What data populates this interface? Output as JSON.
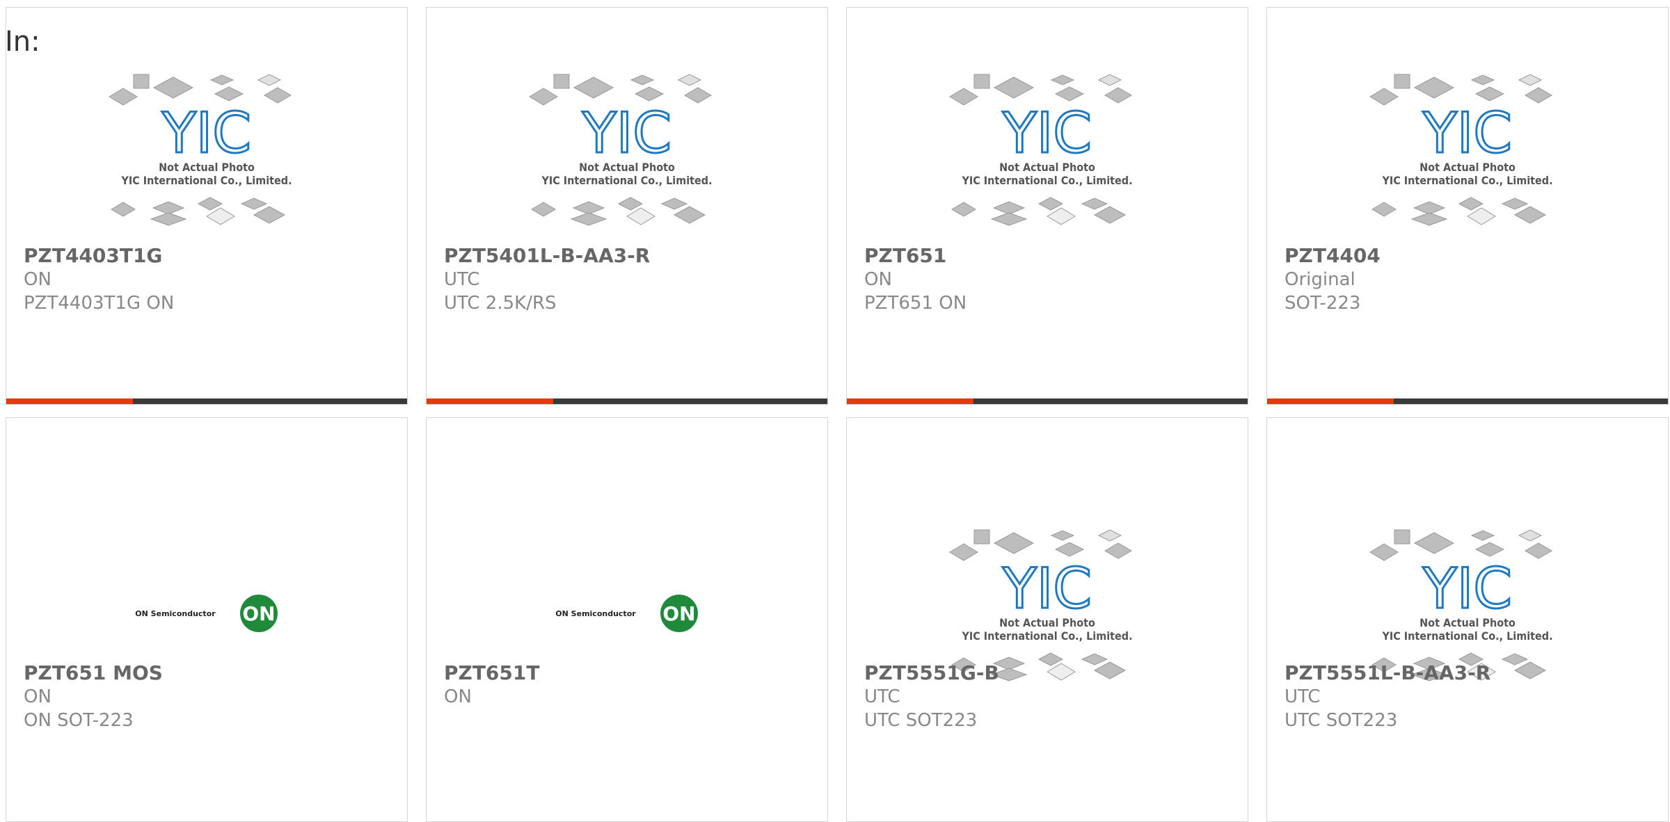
{
  "heading": "In:",
  "colors": {
    "accent": "#e8380d",
    "bar": "#3a3a3a",
    "text": "#777777"
  },
  "placeholder": {
    "logo": "YIC",
    "caption1": "Not Actual Photo",
    "caption2": "YIC International Co., Limited."
  },
  "on_logo": {
    "text": "ON Semiconductor",
    "badge": "ON"
  },
  "products": [
    {
      "name": "PZT4403T1G",
      "line1": "ON",
      "line2": "PZT4403T1G ON",
      "image": "yic-placeholder"
    },
    {
      "name": "PZT5401L-B-AA3-R",
      "line1": "UTC",
      "line2": "UTC 2.5K/RS",
      "image": "yic-placeholder"
    },
    {
      "name": "PZT651",
      "line1": "ON",
      "line2": "PZT651 ON",
      "image": "yic-placeholder"
    },
    {
      "name": "PZT4404",
      "line1": "Original",
      "line2": "SOT-223",
      "image": "yic-placeholder"
    },
    {
      "name": "PZT651 MOS",
      "line1": "ON",
      "line2": "ON SOT-223",
      "image": "on-semiconductor-logo"
    },
    {
      "name": "PZT651T",
      "line1": "ON",
      "line2": "",
      "image": "on-semiconductor-logo"
    },
    {
      "name": "PZT5551G-B",
      "line1": "UTC",
      "line2": "UTC SOT223",
      "image": "yic-placeholder"
    },
    {
      "name": "PZT5551L-B-AA3-R",
      "line1": "UTC",
      "line2": "UTC SOT223",
      "image": "yic-placeholder"
    }
  ]
}
